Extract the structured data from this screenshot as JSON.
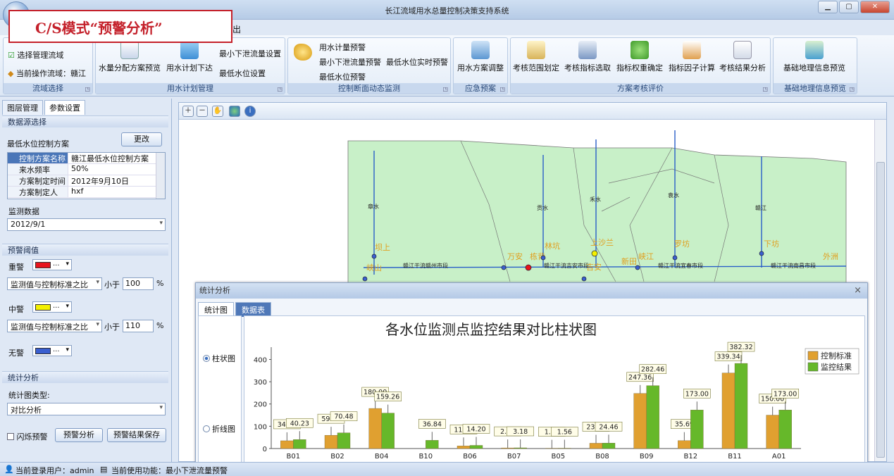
{
  "window": {
    "title": "长江流域用水总量控制决策支持系统"
  },
  "overlay_label": "C/S模式“预警分析”",
  "menu": {
    "item": "出"
  },
  "ribbon": {
    "g1": {
      "label": "流域选择",
      "select": "选择管理流域",
      "current": "当前操作流域：赣江"
    },
    "g2": {
      "label": "用水计划管理",
      "b1": "水量分配方案预览",
      "b2": "用水计划下达",
      "b3": "最小下泄流量设置",
      "b4": "最低水位设置"
    },
    "g3": {
      "label": "控制断面动态监测",
      "b1": "用水计量预警",
      "b2": "最小下泄流量预警",
      "b3": "最低水位实时预警",
      "b4": "最低水位预警"
    },
    "g4": {
      "label": "应急预案",
      "b1": "用水方案调整"
    },
    "g5": {
      "label": "方案考核评价",
      "b1": "考核范围划定",
      "b2": "考核指标选取",
      "b3": "指标权重确定",
      "b4": "指标因子计算",
      "b5": "考核结果分析"
    },
    "g6": {
      "label": "基础地理信息预览",
      "b1": "基础地理信息预览"
    }
  },
  "left": {
    "tabs": [
      "图层管理",
      "参数设置"
    ],
    "ds_head": "数据源选择",
    "scheme_label": "最低水位控制方案",
    "change_btn": "更改",
    "props": [
      [
        "控制方案名称",
        "赣江最低水位控制方案"
      ],
      [
        "来水频率",
        "50%"
      ],
      [
        "方案制定时间",
        "2012年9月10日"
      ],
      [
        "方案制定人",
        "hxf"
      ]
    ],
    "monitor_label": "监测数据",
    "monitor_date": "2012/9/1",
    "warn_head": "预警阈值",
    "levels": [
      {
        "name": "重警",
        "color": "#e8141c"
      },
      {
        "name": "中警",
        "color": "#f4f000"
      },
      {
        "name": "无警",
        "color": "#3a5fd0"
      }
    ],
    "ratio_select": "监测值与控制标准之比",
    "less_than": "小于",
    "th1": "100",
    "th2": "110",
    "pct": "%",
    "dots": "...",
    "stat_head": "统计分析",
    "chart_type_label": "统计图类型:",
    "chart_type": "对比分析",
    "flash": "闪烁预警",
    "analyze_btn": "预警分析",
    "save_btn": "预警结果保存"
  },
  "map": {
    "rivers": [
      "章水",
      "贡水",
      "禾水",
      "袁水",
      "赣江"
    ],
    "stations": [
      "坝上",
      "万安",
      "栋背",
      "林坑",
      "上沙兰",
      "峡江",
      "罗坊",
      "下坊",
      "外洲",
      "新田",
      "吉安"
    ],
    "segments": [
      "赣江干流赣州市段",
      "赣江干流吉安市段",
      "赣江干流宜春市段",
      "赣江干流南昌市段"
    ],
    "partial": [
      "峡山"
    ]
  },
  "stat": {
    "title": "统计分析",
    "close": "×",
    "tabs": [
      "统计图",
      "数据表"
    ],
    "radio1": "柱状图",
    "radio2": "折线图"
  },
  "chart_data": {
    "type": "bar",
    "title": "各水位监测点监控结果对比柱状图",
    "categories": [
      "B01",
      "B02",
      "B04",
      "B10",
      "B06",
      "B07",
      "B05",
      "B08",
      "B09",
      "B12",
      "B11",
      "A01"
    ],
    "series": [
      {
        "name": "控制标准",
        "color": "#e0a030",
        "values": [
          34.94,
          59.56,
          180.0,
          0,
          11.76,
          2.76,
          1.27,
          23.84,
          247.36,
          35.69,
          339.34,
          150.0
        ]
      },
      {
        "name": "监控结果",
        "color": "#66b82a",
        "values": [
          40.23,
          70.48,
          159.26,
          36.84,
          14.2,
          3.18,
          1.56,
          24.46,
          282.46,
          173.0,
          382.32,
          173.0
        ]
      }
    ],
    "labels": {
      "s0": [
        "34.94",
        "59.56",
        "180.00",
        "",
        "11.76",
        "2.76",
        "1.27",
        "23.84",
        "247.36",
        "35.69",
        "339.34",
        "150.00"
      ],
      "s1": [
        "40.23",
        "70.48",
        "159.26",
        "36.84",
        "14.20",
        "3.18",
        "1.56",
        "24.46",
        "282.46",
        "173.00",
        "382.32",
        "173.00"
      ]
    },
    "yticks": [
      0,
      100,
      200,
      300,
      400
    ],
    "ylim": [
      0,
      430
    ],
    "legend": "top-right"
  },
  "status": {
    "user": "当前登录用户：admin",
    "func": "当前使用功能：最小下泄流量预警"
  }
}
